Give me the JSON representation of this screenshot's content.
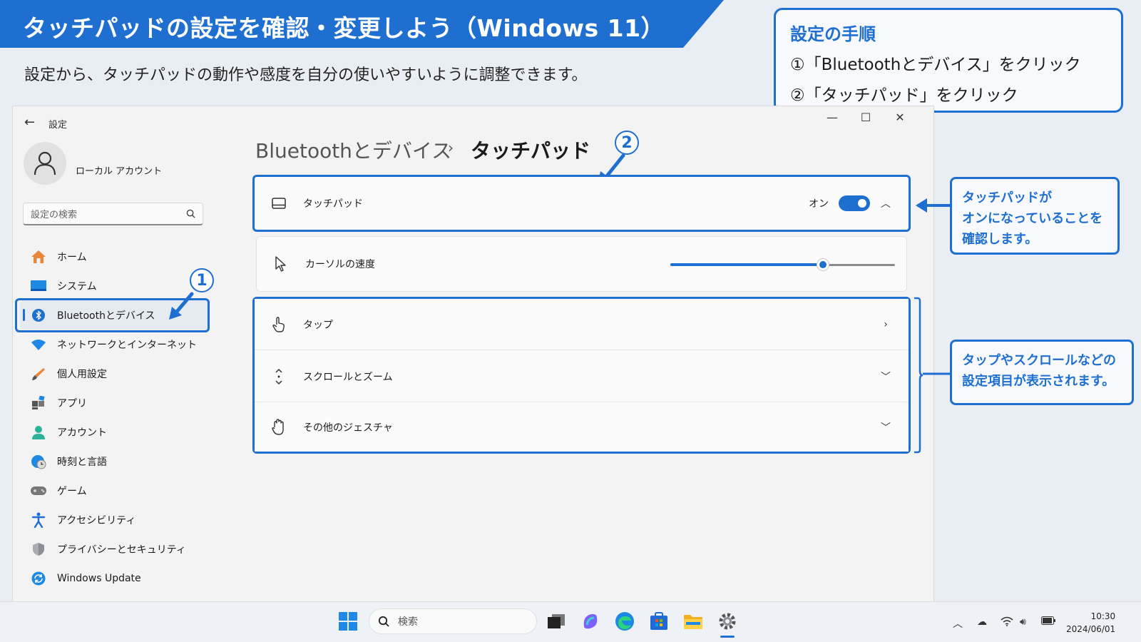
{
  "header": {
    "title": "タッチパッドの設定を確認・変更しよう（Windows 11）",
    "subtitle": "設定から、タッチパッドの動作や感度を自分の使いやすいように調整できます。"
  },
  "steps": {
    "title": "設定の手順",
    "lines": [
      "①「Bluetoothとデバイス」をクリック",
      "②「タッチパッド」をクリック"
    ]
  },
  "window": {
    "title": "設定",
    "account": "ローカル アカウント",
    "search_placeholder": "設定の検索"
  },
  "nav": [
    {
      "label": "ホーム",
      "icon": "home-icon"
    },
    {
      "label": "システム",
      "icon": "system-icon"
    },
    {
      "label": "Bluetoothとデバイス",
      "icon": "bluetooth-icon",
      "active": true
    },
    {
      "label": "ネットワークとインターネット",
      "icon": "wifi-icon"
    },
    {
      "label": "個人用設定",
      "icon": "brush-icon"
    },
    {
      "label": "アプリ",
      "icon": "apps-icon"
    },
    {
      "label": "アカウント",
      "icon": "person-icon"
    },
    {
      "label": "時刻と言語",
      "icon": "globe-clock-icon"
    },
    {
      "label": "ゲーム",
      "icon": "gamepad-icon"
    },
    {
      "label": "アクセシビリティ",
      "icon": "accessibility-icon"
    },
    {
      "label": "プライバシーとセキュリティ",
      "icon": "shield-icon"
    },
    {
      "label": "Windows Update",
      "icon": "update-icon"
    }
  ],
  "breadcrumb": {
    "parent": "Bluetoothとデバイス",
    "separator": "›",
    "current": "タッチパッド"
  },
  "settings": {
    "touchpad": {
      "label": "タッチパッド",
      "state": "オン",
      "on": true
    },
    "cursor_speed": {
      "label": "カーソルの速度",
      "value": 0.68
    },
    "tap": {
      "label": "タップ"
    },
    "scroll_zoom": {
      "label": "スクロールとズーム"
    },
    "other_gestures": {
      "label": "その他のジェスチャ"
    }
  },
  "callouts": {
    "touchpad_on": [
      "タッチパッドが",
      "オンになっていることを",
      "確認します。"
    ],
    "items": [
      "タップやスクロールなどの",
      "設定項目が表示されます。"
    ]
  },
  "markers": {
    "one": "1",
    "two": "2"
  },
  "taskbar": {
    "search_placeholder": "検索",
    "time": "10:30",
    "date": "2024/06/01"
  },
  "colors": {
    "accent": "#1f6fd1"
  }
}
